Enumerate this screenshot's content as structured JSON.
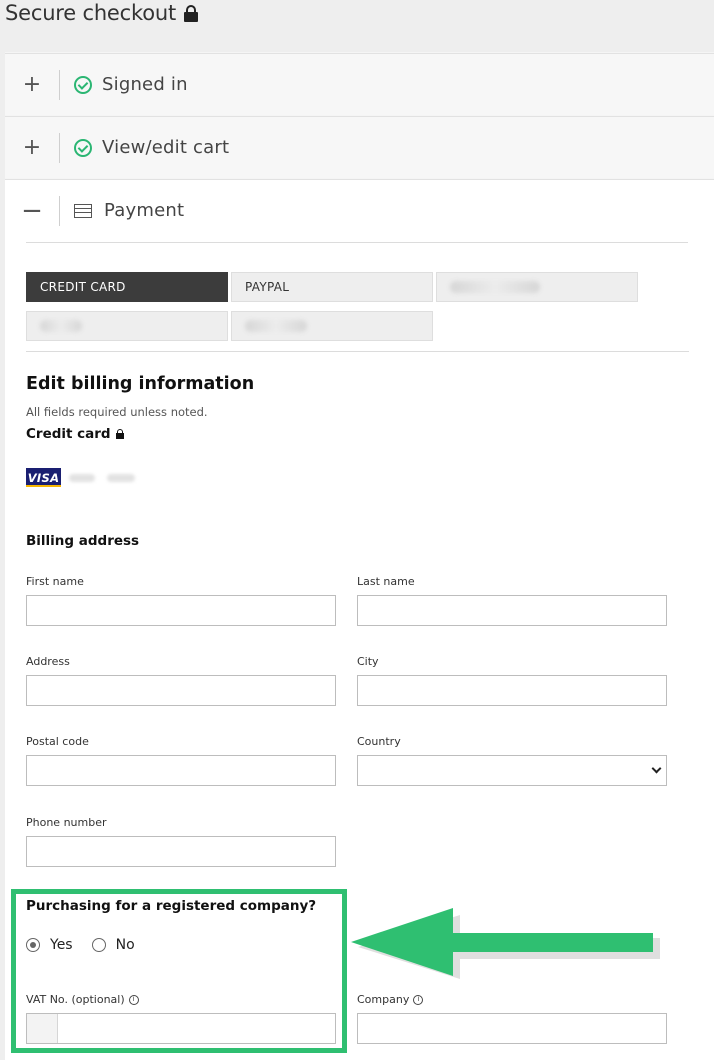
{
  "page": {
    "title": "Secure checkout"
  },
  "accordion": {
    "signed_in": {
      "toggle": "+",
      "label": "Signed in"
    },
    "cart": {
      "toggle": "+",
      "label": "View/edit cart"
    },
    "payment": {
      "toggle": "−",
      "label": "Payment"
    }
  },
  "payment_methods": {
    "credit_card": "CREDIT CARD",
    "paypal": "PAYPAL"
  },
  "billing": {
    "heading": "Edit billing information",
    "required_note": "All fields required unless noted.",
    "credit_card_label": "Credit card",
    "card_brand": "VISA",
    "address_heading": "Billing address",
    "fields": {
      "first_name": {
        "label": "First name",
        "value": ""
      },
      "last_name": {
        "label": "Last name",
        "value": ""
      },
      "address": {
        "label": "Address",
        "value": ""
      },
      "city": {
        "label": "City",
        "value": ""
      },
      "postal_code": {
        "label": "Postal code",
        "value": ""
      },
      "country": {
        "label": "Country",
        "value": ""
      },
      "phone": {
        "label": "Phone number",
        "value": ""
      },
      "vat": {
        "label": "VAT No. (optional)",
        "value": ""
      },
      "company": {
        "label": "Company",
        "value": ""
      }
    },
    "company_question": "Purchasing for a registered company?",
    "radio": {
      "yes": "Yes",
      "no": "No",
      "selected": "Yes"
    }
  },
  "annotation": {
    "color": "#2fbf71"
  },
  "colors": {
    "accent_green": "#2bb673",
    "active_tab": "#3c3c3c",
    "visa_blue": "#1a1f71"
  }
}
